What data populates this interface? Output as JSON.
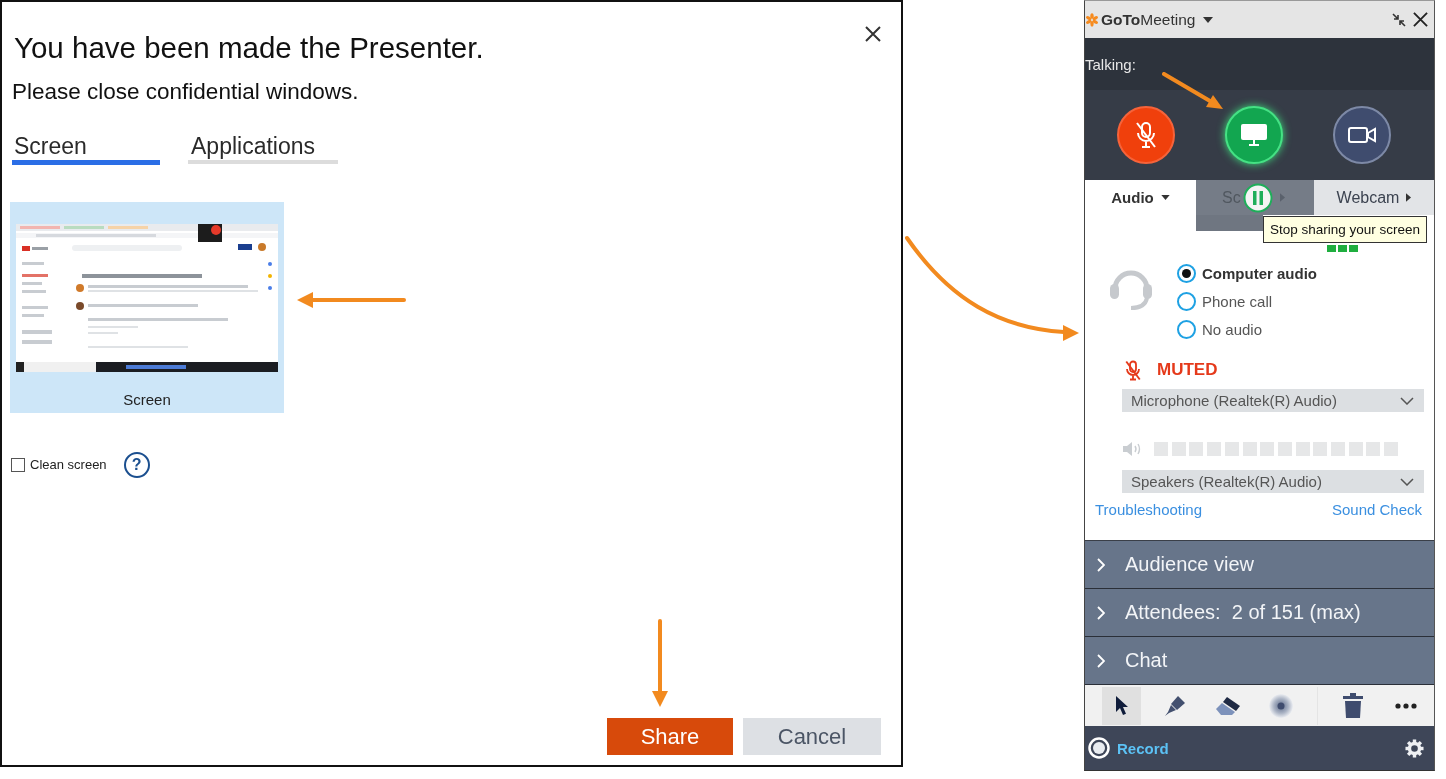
{
  "dialog": {
    "title": "You have been made the Presenter.",
    "subtitle": "Please close confidential windows.",
    "tabs": [
      {
        "label": "Screen",
        "selected": true
      },
      {
        "label": "Applications",
        "selected": false
      }
    ],
    "share_options": [
      {
        "label": "Screen",
        "selected": true
      }
    ],
    "clean_screen": {
      "label": "Clean screen",
      "checked": false
    },
    "help": "?",
    "buttons": [
      {
        "label": "Share",
        "kind": "primary"
      },
      {
        "label": "Cancel",
        "kind": "secondary"
      }
    ]
  },
  "meeting_panel": {
    "app_name": "**GoTo**Meeting",
    "talking_label": "Talking:",
    "mic_muted": true,
    "screen_sharing": true,
    "webcam_on": false,
    "tabs": [
      {
        "label": "Audio",
        "selected": true
      },
      {
        "label": "Sc",
        "selected": false
      },
      {
        "label": "Webcam",
        "selected": false
      }
    ],
    "tooltip": "Stop sharing your screen",
    "audio_options": [
      {
        "label": "Computer audio",
        "selected": true
      },
      {
        "label": "Phone call",
        "selected": false
      },
      {
        "label": "No audio",
        "selected": false
      }
    ],
    "mute_status": "MUTED",
    "microphone_device": "Microphone (Realtek(R) Audio)",
    "speaker_device": "Speakers (Realtek(R) Audio)",
    "links": [
      "Troubleshooting",
      "Sound Check"
    ],
    "sections": [
      {
        "label": "Audience view",
        "expanded": false
      },
      {
        "label": "Attendees:  2 of 151 (max)",
        "expanded": false
      },
      {
        "label": "Chat",
        "expanded": false
      }
    ],
    "annotation_tools": [
      {
        "selected": true
      },
      {
        "selected": false
      },
      {
        "selected": false
      },
      {
        "selected": false
      }
    ],
    "record_label": "Record"
  }
}
